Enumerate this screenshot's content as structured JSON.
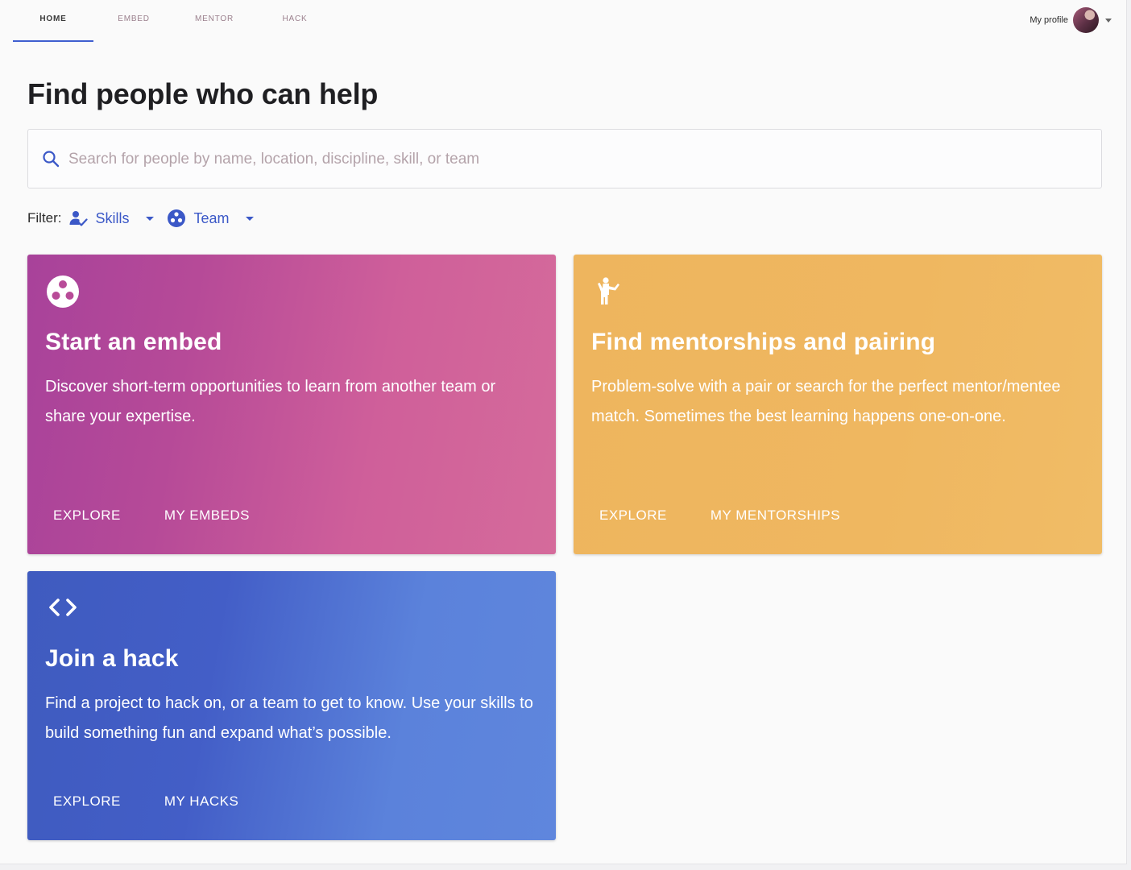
{
  "nav": {
    "tabs": [
      {
        "label": "HOME",
        "active": true
      },
      {
        "label": "EMBED",
        "active": false
      },
      {
        "label": "MENTOR",
        "active": false
      },
      {
        "label": "HACK",
        "active": false
      }
    ],
    "profile_label": "My profile"
  },
  "main": {
    "title": "Find people who can help",
    "search": {
      "placeholder": "Search for people by name, location, discipline, skill, or team",
      "value": ""
    },
    "filter": {
      "label": "Filter:",
      "skills_label": "Skills",
      "team_label": "Team"
    }
  },
  "cards": {
    "embed": {
      "icon": "team-dots-icon",
      "title": "Start an embed",
      "description": "Discover short-term opportunities to learn from another team or share your expertise.",
      "actions": [
        "EXPLORE",
        "MY EMBEDS"
      ],
      "color": "#c0509a"
    },
    "mentor": {
      "icon": "person-waving-icon",
      "title": "Find mentorships and pairing",
      "description": "Problem-solve with a pair or search for the perfect mentor/mentee match. Sometimes the best learning happens one-on-one.",
      "actions": [
        "EXPLORE",
        "MY MENTORSHIPS"
      ],
      "color": "#efb760"
    },
    "hack": {
      "icon": "code-brackets-icon",
      "title": "Join a hack",
      "description": "Find a project to hack on, or a team to get to know. Use your skills to build something fun and expand what’s possible.",
      "actions": [
        "EXPLORE",
        "MY HACKS"
      ],
      "color": "#4c6fd2"
    }
  },
  "colors": {
    "accent": "#3b58c7",
    "title_text": "#1f1f22"
  }
}
